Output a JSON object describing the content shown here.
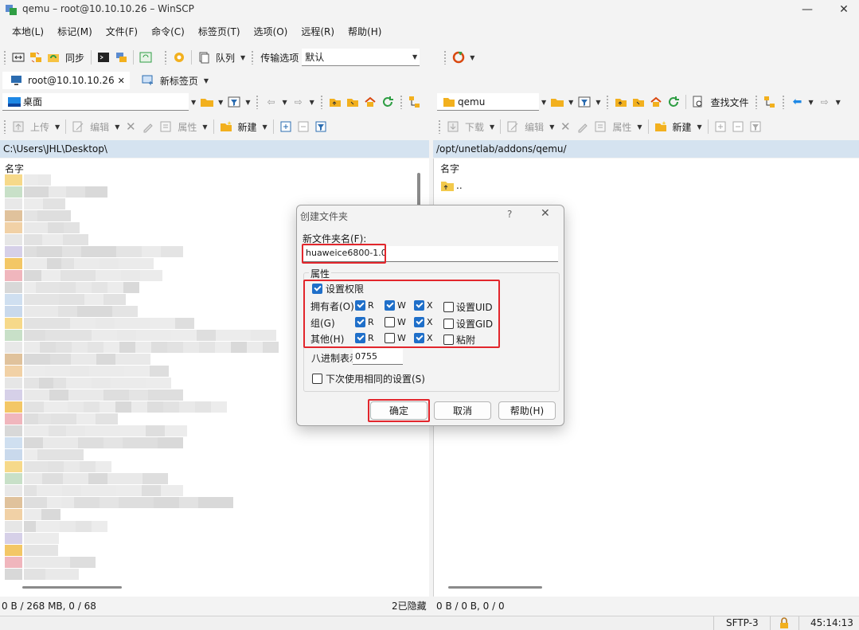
{
  "window": {
    "title": "qemu – root@10.10.10.26 – WinSCP",
    "minimize": "—",
    "maximize": "☐",
    "close": "✕"
  },
  "menu": [
    "本地(L)",
    "标记(M)",
    "文件(F)",
    "命令(C)",
    "标签页(T)",
    "选项(O)",
    "远程(R)",
    "帮助(H)"
  ],
  "toolbar": {
    "sync_label": "同步",
    "queue_label": "队列",
    "transfer_label": "传输选项",
    "transfer_value": "默认"
  },
  "tabs": {
    "session": "root@10.10.10.26",
    "session_close": "✕",
    "new_tab": "新标签页"
  },
  "left": {
    "location": "桌面",
    "upload": "上传",
    "edit": "编辑",
    "properties": "属性",
    "new": "新建",
    "path": "C:\\Users\\JHL\\Desktop\\",
    "col_name": "名字",
    "status": "0 B / 268 MB,  0 / 68",
    "hidden": "2已隐藏"
  },
  "right": {
    "location": "qemu",
    "find": "查找文件",
    "download": "下载",
    "edit": "编辑",
    "properties": "属性",
    "new": "新建",
    "path": "/opt/unetlab/addons/qemu/",
    "col_name": "名字",
    "parent_dir": "..",
    "status": "0 B / 0 B,  0 / 0"
  },
  "bottom": {
    "protocol": "SFTP-3",
    "time": "45:14:13"
  },
  "dialog": {
    "title": "创建文件夹",
    "help_q": "?",
    "close": "✕",
    "name_label": "新文件夹名(F):",
    "name_value": "huaweice6800-1.0",
    "attributes_label": "属性",
    "set_perms_label": "设置权限",
    "owner_label": "拥有者(O)",
    "group_label": "组(G)",
    "other_label": "其他(H)",
    "r": "R",
    "w": "W",
    "x": "X",
    "setuid": "设置UID",
    "setgid": "设置GID",
    "sticky": "粘附",
    "octal_label": "八进制表示",
    "octal_value": "0755",
    "reuse_label": "下次使用相同的设置(S)",
    "ok": "确定",
    "cancel": "取消",
    "help": "帮助(H)"
  },
  "colors": {
    "highlight": "#e2262c",
    "path_bar": "#d5e3f0",
    "checkbox": "#1f6fc9"
  }
}
